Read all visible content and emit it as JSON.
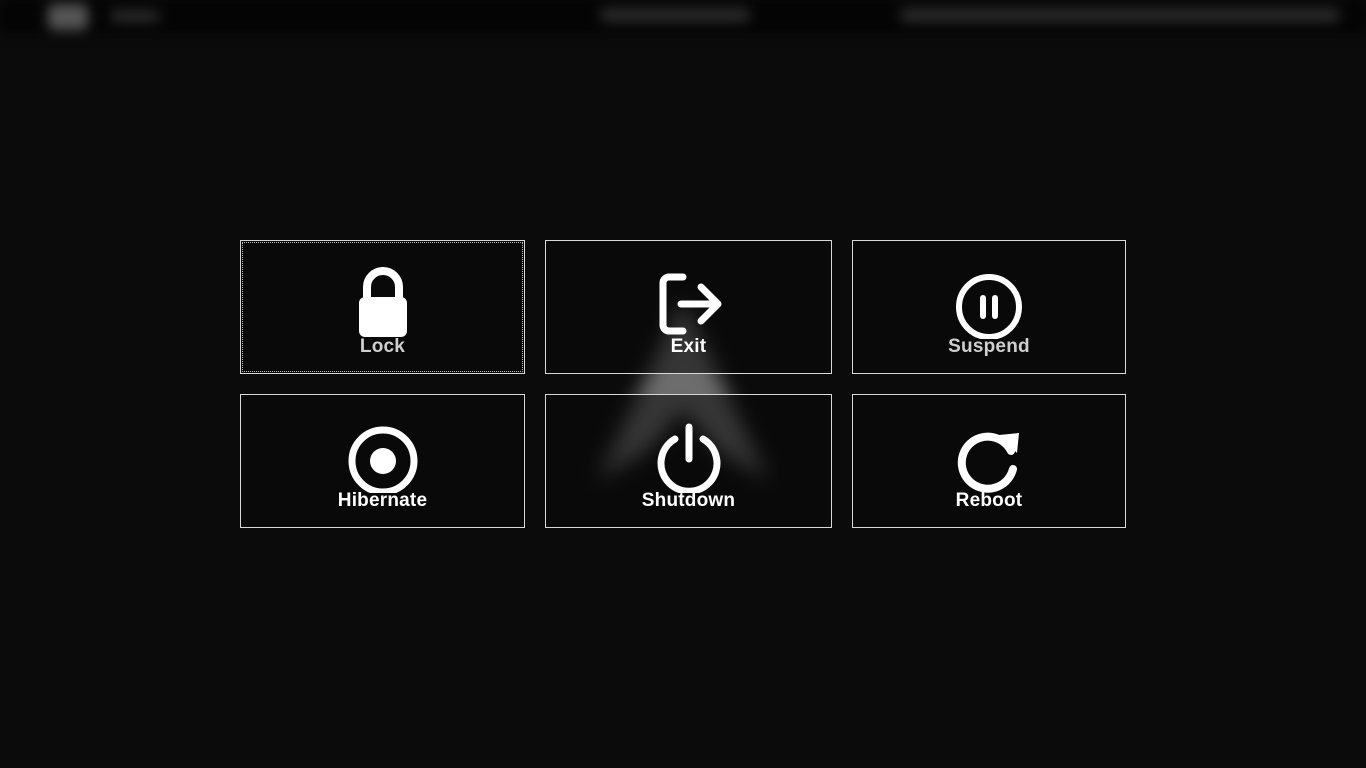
{
  "logout_menu": {
    "buttons": [
      {
        "label": "Lock",
        "icon": "lock-icon",
        "focused": true
      },
      {
        "label": "Exit",
        "icon": "logout-icon",
        "focused": false
      },
      {
        "label": "Suspend",
        "icon": "pause-circle-icon",
        "focused": false
      },
      {
        "label": "Hibernate",
        "icon": "record-circle-icon",
        "focused": false
      },
      {
        "label": "Shutdown",
        "icon": "power-icon",
        "focused": false
      },
      {
        "label": "Reboot",
        "icon": "restart-icon",
        "focused": false
      }
    ]
  },
  "colors": {
    "background": "#0b0b0b",
    "border": "#d8d8d8",
    "text": "#ffffff"
  }
}
